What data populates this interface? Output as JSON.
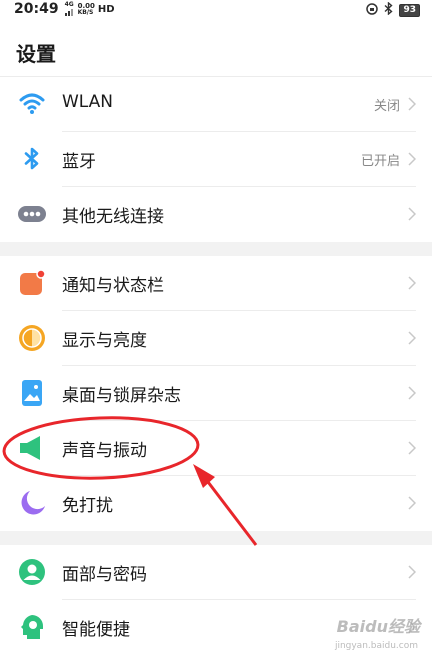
{
  "status_bar": {
    "time": "20:49",
    "network_top": "4G",
    "speed_value": "0.00",
    "speed_unit": "KB/S",
    "hd": "HD",
    "battery": "93"
  },
  "page_title": "设置",
  "groups": [
    {
      "items": [
        {
          "label": "WLAN",
          "value": "关闭",
          "icon": "wifi-icon"
        },
        {
          "label": "蓝牙",
          "value": "已开启",
          "icon": "bluetooth-icon"
        },
        {
          "label": "其他无线连接",
          "value": "",
          "icon": "more-dots-icon"
        }
      ]
    },
    {
      "items": [
        {
          "label": "通知与状态栏",
          "value": "",
          "icon": "notification-icon"
        },
        {
          "label": "显示与亮度",
          "value": "",
          "icon": "brightness-icon"
        },
        {
          "label": "桌面与锁屏杂志",
          "value": "",
          "icon": "wallpaper-icon"
        },
        {
          "label": "声音与振动",
          "value": "",
          "icon": "speaker-icon"
        },
        {
          "label": "免打扰",
          "value": "",
          "icon": "moon-icon"
        }
      ]
    },
    {
      "items": [
        {
          "label": "面部与密码",
          "value": "",
          "icon": "face-user-icon"
        },
        {
          "label": "智能便捷",
          "value": "",
          "icon": "smart-head-icon"
        }
      ]
    }
  ],
  "colors": {
    "accent_blue": "#2d9bf0",
    "annotation_red": "#e8262b",
    "divider": "#ececec",
    "section_bg": "#f2f2f2"
  },
  "watermark": {
    "brand": "Baidu经验",
    "url": "jingyan.baidu.com"
  }
}
